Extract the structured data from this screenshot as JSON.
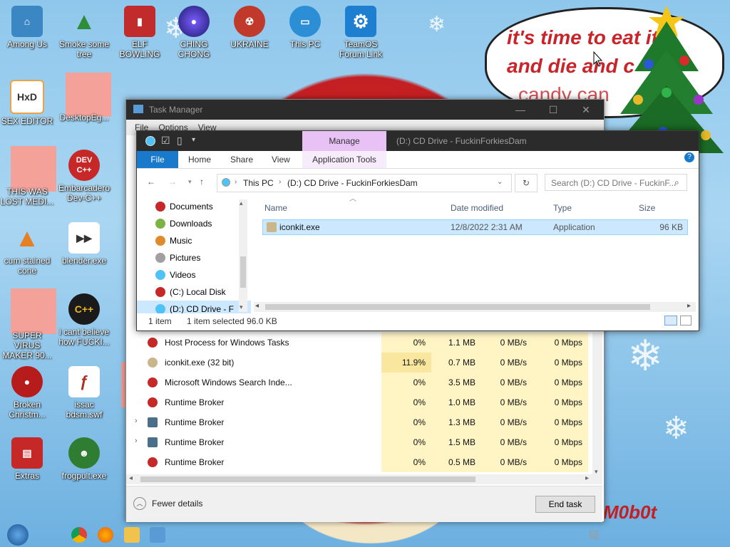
{
  "desktop": {
    "icons": [
      {
        "label": "Among Us",
        "color": "#3b87c4"
      },
      {
        "label": "Smoke some tree",
        "color": "#3a8a3a"
      },
      {
        "label": "ELF BOWLING",
        "color": "#c12b2b"
      },
      {
        "label": "CHING CHONG",
        "color": "#2a2a9a"
      },
      {
        "label": "UKRAINE",
        "color": "#c0392b"
      },
      {
        "label": "This PC",
        "color": "#2c8fd6"
      },
      {
        "label": "TeamOS Forum Link",
        "color": "#1e7fd0"
      },
      {
        "label": "SEX EDITOR",
        "color": "#e9a246"
      },
      {
        "label": "DesktopEg...",
        "color": "#f4a19a"
      },
      {
        "label": "THIS WAS LOST MEDI...",
        "color": "#f4a19a"
      },
      {
        "label": "Embarcadero Dev-C++",
        "color": "#c62828"
      },
      {
        "label": "cum stained cone",
        "color": "#e67e22"
      },
      {
        "label": "blender.exe",
        "color": "#333333"
      },
      {
        "label": "SUPER VIRUS MAKER 90...",
        "color": "#f4a19a"
      },
      {
        "label": "i cant believe how FUCKI...",
        "color": "#1a1a1a"
      },
      {
        "label": "Broken Christm...",
        "color": "#b71c1c"
      },
      {
        "label": "issac bdsm.swf",
        "color": "#b0301f"
      },
      {
        "label": "Extras",
        "color": "#c62828"
      },
      {
        "label": "frogpult.exe",
        "color": "#2e7d32"
      }
    ],
    "bubble_lines": [
      "it's time to eat it",
      "and die and c",
      "candy can"
    ],
    "signature": "M0b0t"
  },
  "task_manager": {
    "title": "Task Manager",
    "menu": [
      "File",
      "Options",
      "View"
    ],
    "processes": [
      {
        "name": "Host Process for Windows Tasks",
        "cpu": "0%",
        "mem": "1.1 MB",
        "disk": "0 MB/s",
        "net": "0 Mbps",
        "expand": false,
        "highlight": false
      },
      {
        "name": "iconkit.exe (32 bit)",
        "cpu": "11.9%",
        "mem": "0.7 MB",
        "disk": "0 MB/s",
        "net": "0 Mbps",
        "expand": false,
        "highlight": true
      },
      {
        "name": "Microsoft Windows Search Inde...",
        "cpu": "0%",
        "mem": "3.5 MB",
        "disk": "0 MB/s",
        "net": "0 Mbps",
        "expand": false,
        "highlight": false
      },
      {
        "name": "Runtime Broker",
        "cpu": "0%",
        "mem": "1.0 MB",
        "disk": "0 MB/s",
        "net": "0 Mbps",
        "expand": false,
        "highlight": false
      },
      {
        "name": "Runtime Broker",
        "cpu": "0%",
        "mem": "1.3 MB",
        "disk": "0 MB/s",
        "net": "0 Mbps",
        "expand": true,
        "highlight": false
      },
      {
        "name": "Runtime Broker",
        "cpu": "0%",
        "mem": "1.5 MB",
        "disk": "0 MB/s",
        "net": "0 Mbps",
        "expand": true,
        "highlight": false
      },
      {
        "name": "Runtime Broker",
        "cpu": "0%",
        "mem": "0.5 MB",
        "disk": "0 MB/s",
        "net": "0 Mbps",
        "expand": false,
        "highlight": false
      }
    ],
    "fewer_details": "Fewer details",
    "end_task": "End task"
  },
  "explorer": {
    "title": "(D:) CD Drive - FuckinForkiesDam",
    "manage_tab": "Manage",
    "ribbon_tabs": [
      "File",
      "Home",
      "Share",
      "View",
      "Application Tools"
    ],
    "breadcrumb": [
      "This PC",
      "(D:) CD Drive - FuckinForkiesDam"
    ],
    "search_placeholder": "Search (D:) CD Drive - FuckinF...",
    "nav": [
      {
        "label": "Documents",
        "color": "#c62828"
      },
      {
        "label": "Downloads",
        "color": "#7cb342"
      },
      {
        "label": "Music",
        "color": "#e08a2c"
      },
      {
        "label": "Pictures",
        "color": "#a0a0a0"
      },
      {
        "label": "Videos",
        "color": "#4fc3f7"
      },
      {
        "label": "(C:) Local Disk",
        "color": "#c62828"
      },
      {
        "label": "(D:) CD Drive - F",
        "color": "#4fc3f7"
      }
    ],
    "columns": [
      "Name",
      "Date modified",
      "Type",
      "Size"
    ],
    "files": [
      {
        "name": "iconkit.exe",
        "date": "12/8/2022 2:31 AM",
        "type": "Application",
        "size": "96 KB"
      }
    ],
    "status_items": "1 item",
    "status_selected": "1 item selected  96.0 KB"
  },
  "colors": {
    "accent": "#1979ca",
    "manage": "#e8c2f5",
    "highlight": "#fff4c4"
  }
}
